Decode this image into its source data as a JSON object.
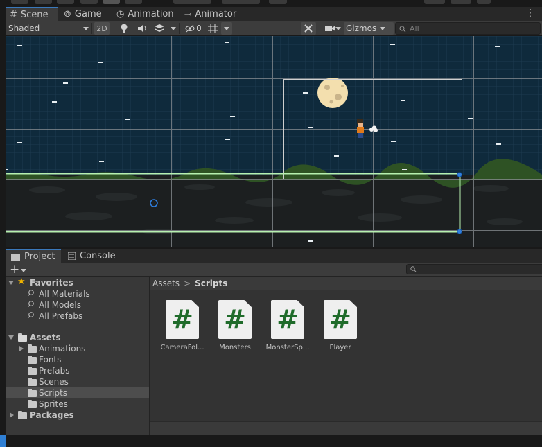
{
  "scene_panel": {
    "tabs": [
      {
        "label": "Scene",
        "icon": "grid-icon"
      },
      {
        "label": "Game",
        "icon": "gamepad-icon"
      },
      {
        "label": "Animation",
        "icon": "clock-icon"
      },
      {
        "label": "Animator",
        "icon": "animator-icon"
      }
    ],
    "toolbar": {
      "shading_mode": "Shaded",
      "mode_2d": "2D",
      "hidden_count": "0",
      "gizmos_label": "Gizmos",
      "search_placeholder": "All"
    }
  },
  "project_panel": {
    "tabs": [
      {
        "label": "Project",
        "icon": "folder-icon"
      },
      {
        "label": "Console",
        "icon": "console-icon"
      }
    ],
    "add_button": "+",
    "favorites": {
      "label": "Favorites",
      "items": [
        "All Materials",
        "All Models",
        "All Prefabs"
      ]
    },
    "assets": {
      "label": "Assets",
      "items": [
        "Animations",
        "Fonts",
        "Prefabs",
        "Scenes",
        "Scripts",
        "Sprites"
      ],
      "selected": "Scripts"
    },
    "packages_label": "Packages",
    "breadcrumb": {
      "root": "Assets",
      "current": "Scripts",
      "separator": ">"
    },
    "files": [
      {
        "name": "CameraFol...",
        "icon": "csharp-script-icon"
      },
      {
        "name": "Monsters",
        "icon": "csharp-script-icon"
      },
      {
        "name": "MonsterSp...",
        "icon": "csharp-script-icon"
      },
      {
        "name": "Player",
        "icon": "csharp-script-icon"
      }
    ],
    "script_glyph": "#"
  },
  "colors": {
    "sky": "#0f2a3c",
    "grid_line": "#8a8f93",
    "selection": "#b7f0b0",
    "handle": "#2f7fe0",
    "ground": "#1c1f20",
    "grass": "#2e5224",
    "script_green": "#1f6b2a",
    "accent": "#3a79bb"
  }
}
